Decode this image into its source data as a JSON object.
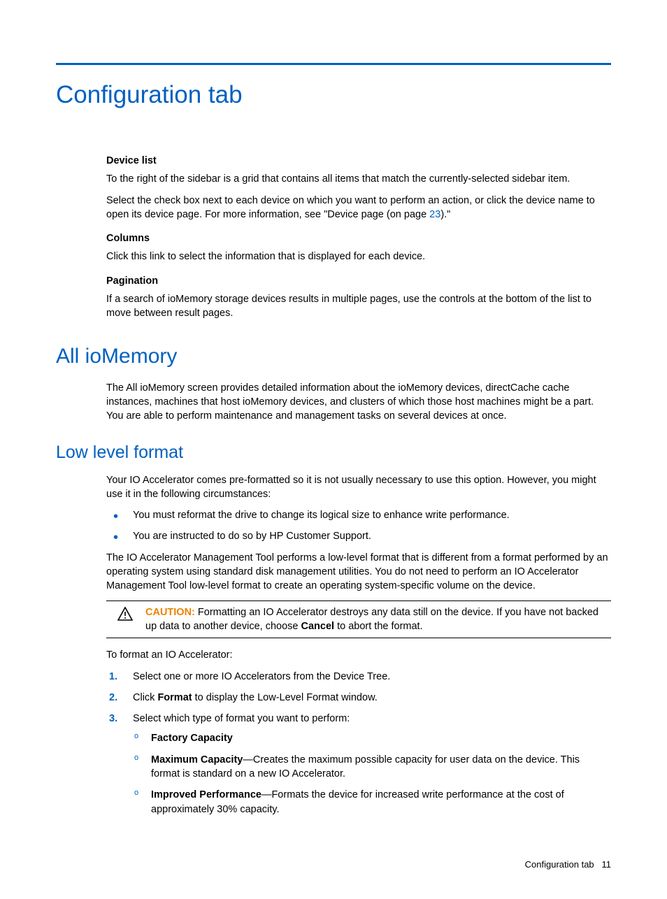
{
  "page_title": "Configuration tab",
  "device_list": {
    "label": "Device list",
    "p1": "To the right of the sidebar is a grid that contains all items that match the currently-selected sidebar item.",
    "p2_a": "Select the check box next to each device on which you want to perform an action, or click the device name to open its device page. For more information, see \"Device page (on page ",
    "p2_link": "23",
    "p2_b": ").\""
  },
  "columns": {
    "label": "Columns",
    "p1": "Click this link to select the information that is displayed for each device."
  },
  "pagination": {
    "label": "Pagination",
    "p1": "If a search of ioMemory storage devices results in multiple pages, use the controls at the bottom of the list to move between result pages."
  },
  "all_iomemory": {
    "title": "All ioMemory",
    "p1": "The All ioMemory screen provides detailed information about the ioMemory devices, directCache cache instances, machines that host ioMemory devices, and clusters of which those host machines might be a part. You are able to perform maintenance and management tasks on several devices at once."
  },
  "low_level_format": {
    "title": "Low level format",
    "intro": "Your IO Accelerator comes pre-formatted so it is not usually necessary to use this option. However, you might use it in the following circumstances:",
    "bullets": [
      "You must reformat the drive to change its logical size to enhance write performance.",
      "You are instructed to do so by HP Customer Support."
    ],
    "p2": "The IO Accelerator Management Tool performs a low-level format that is different from a format performed by an operating system using standard disk management utilities. You do not need to perform an IO Accelerator Management Tool low-level format to create an operating system-specific volume on the device.",
    "caution_label": "CAUTION:",
    "caution_a": "  Formatting an IO Accelerator destroys any data still on the device. If you have not backed up data to another device, choose ",
    "caution_bold": "Cancel",
    "caution_b": " to abort the format.",
    "p3": "To format an IO Accelerator:",
    "steps": {
      "s1": "Select one or more IO Accelerators from the Device Tree.",
      "s2_a": "Click ",
      "s2_bold": "Format",
      "s2_b": " to display the Low-Level Format window.",
      "s3": "Select which type of format you want to perform:",
      "opts": {
        "o1": "Factory Capacity",
        "o2_bold": "Maximum Capacity",
        "o2_rest": "—Creates the maximum possible capacity for user data on the device. This format is standard on a new IO Accelerator.",
        "o3_bold": "Improved Performance",
        "o3_rest": "—Formats the device for increased write performance at the cost of approximately 30% capacity."
      }
    }
  },
  "footer": {
    "section": "Configuration tab",
    "page": "11"
  }
}
